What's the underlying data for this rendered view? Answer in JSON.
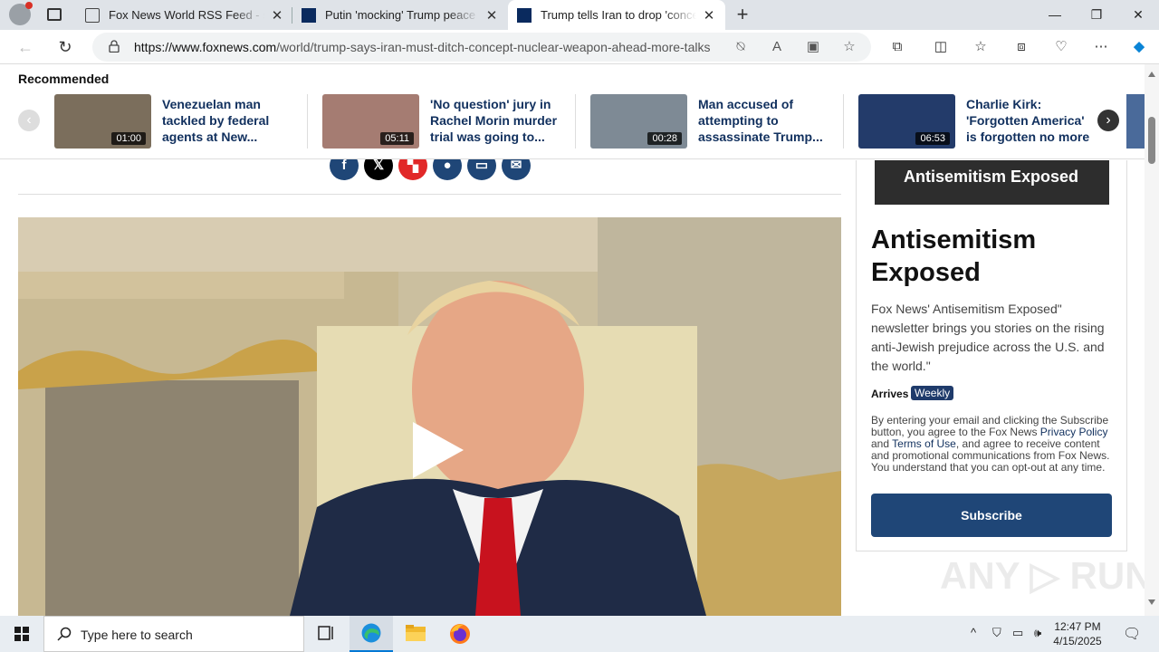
{
  "browser": {
    "tabs": [
      {
        "title": "Fox News World RSS Feed - socc",
        "favicon": "page-icon"
      },
      {
        "title": "Putin 'mocking' Trump peace eff",
        "favicon": "fox-news-icon"
      },
      {
        "title": "Trump tells Iran to drop 'concept",
        "favicon": "fox-news-icon"
      }
    ],
    "url_domain": "https://www.foxnews.com",
    "url_path": "/world/trump-says-iran-must-ditch-concept-nuclear-weapon-ahead-more-talks",
    "window_controls": {
      "minimize": "—",
      "restore": "❐",
      "close": "✕"
    }
  },
  "recommended": {
    "heading": "Recommended",
    "cards": [
      {
        "title": "Venezuelan man tackled by federal agents at New...",
        "duration": "01:00",
        "color": "#7b6e5c"
      },
      {
        "title": "'No question' jury in Rachel Morin murder trial was going to...",
        "duration": "05:11",
        "color": "#a57c72"
      },
      {
        "title": "Man accused of attempting to assassinate Trump...",
        "duration": "00:28",
        "color": "#7e8a95"
      },
      {
        "title": "Charlie Kirk: 'Forgotten America' is forgotten no more",
        "duration": "06:53",
        "color": "#233b6a"
      }
    ]
  },
  "share": {
    "buttons": [
      {
        "name": "facebook",
        "glyph": "f",
        "color": "#1f4677"
      },
      {
        "name": "x",
        "glyph": "𝕏",
        "color": "#000000"
      },
      {
        "name": "flipboard",
        "glyph": "▚",
        "color": "#e12828"
      },
      {
        "name": "comments",
        "glyph": "●",
        "color": "#1f4677"
      },
      {
        "name": "print",
        "glyph": "▭",
        "color": "#1f4677"
      },
      {
        "name": "email",
        "glyph": "✉",
        "color": "#1f4677"
      }
    ]
  },
  "sidebar": {
    "promo_image_text": "Antisemitism Exposed",
    "title": "Antisemitism Exposed",
    "description": "Fox News' Antisemitism Exposed\" newsletter brings you stories on the rising anti-Jewish prejudice across the U.S. and the world.\"",
    "arrives_label": "Arrives",
    "frequency": "Weekly",
    "legal_prefix": "By entering your email and clicking the Subscribe button, you agree to the Fox News ",
    "privacy_link": "Privacy Policy",
    "legal_and": " and ",
    "terms_link": "Terms of Use",
    "legal_suffix": ", and agree to receive content and promotional communications from Fox News. You understand that you can opt-out at any time.",
    "subscribe_label": "Subscribe"
  },
  "watermark": "ANY ▷ RUN",
  "taskbar": {
    "search_placeholder": "Type here to search",
    "time": "12:47 PM",
    "date": "4/15/2025"
  }
}
